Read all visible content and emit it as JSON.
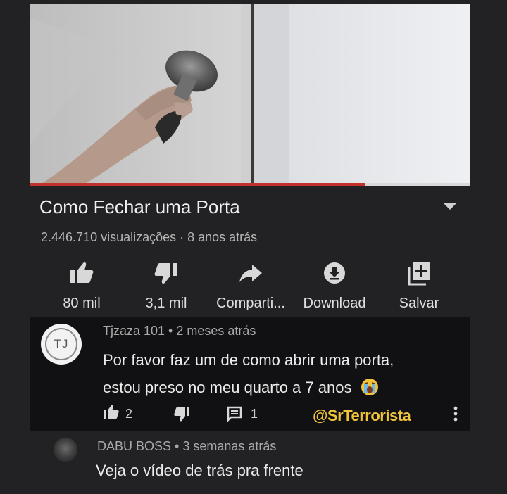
{
  "video": {
    "progress_percent": 76,
    "title": "Como Fechar uma Porta",
    "meta": "2.446.710 visualizações · 8 anos atrás"
  },
  "actions": [
    {
      "icon": "thumbs-up-icon",
      "label": "80 mil"
    },
    {
      "icon": "thumbs-down-icon",
      "label": "3,1 mil"
    },
    {
      "icon": "share-icon",
      "label": "Comparti..."
    },
    {
      "icon": "download-icon",
      "label": "Download"
    },
    {
      "icon": "save-playlist-icon",
      "label": "Salvar"
    }
  ],
  "comment": {
    "avatar_initials": "TJ",
    "author": "Tjzaza 101 • 2 meses atrás",
    "text_line1": "Por favor faz um de como abrir uma porta,",
    "text_line2": "estou preso no meu quarto a 7 anos",
    "emoji": "crying-face-emoji",
    "likes": "2",
    "replies": "1",
    "watermark": "@SrTerrorista"
  },
  "reply": {
    "author": "DABU BOSS • 3 semanas atrás",
    "text": "Veja o vídeo de trás pra frente"
  },
  "colors": {
    "background": "#222224",
    "comment_background": "#111113",
    "progress": "#c4302b",
    "watermark": "#f0c53a"
  }
}
